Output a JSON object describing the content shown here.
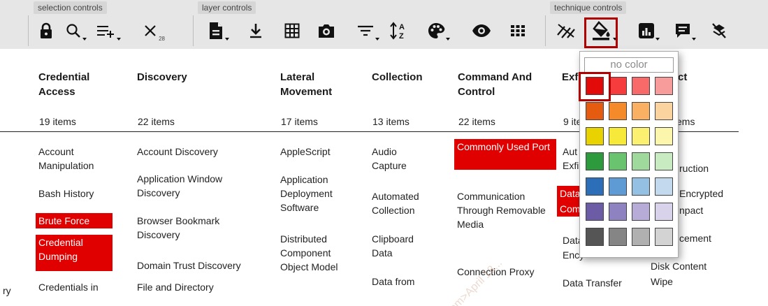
{
  "toolbar": {
    "groups": {
      "selection": "selection controls",
      "layer": "layer controls",
      "technique": "technique controls"
    },
    "icons": {
      "lock": "lock-icon",
      "search": "search-icon",
      "multiselect": "multiselect-icon",
      "deselect": "deselect-icon",
      "deselect_count": "28",
      "layer_info": "layer-info-icon",
      "download": "download-icon",
      "grid": "grid-icon",
      "camera": "camera-icon",
      "filter": "filter-icon",
      "sort": "sort-icon",
      "palette": "palette-icon",
      "eye": "eye-icon",
      "dots": "dots-icon",
      "disable": "disable-icon",
      "fill": "fill-color-icon",
      "score": "score-icon",
      "comment": "comment-icon",
      "clear": "clear-icon"
    }
  },
  "columns": [
    {
      "title": "Credential Access",
      "count": "19 items"
    },
    {
      "title": "Discovery",
      "count": "22 items"
    },
    {
      "title": "Lateral Movement",
      "count": "17 items"
    },
    {
      "title": "Collection",
      "count": "13 items"
    },
    {
      "title": "Command And Control",
      "count": "22 items"
    },
    {
      "title": "Exfi",
      "count": "9 ite"
    },
    {
      "title": "ct",
      "count": "ems"
    }
  ],
  "cells": {
    "c0": [
      "Account Manipulation",
      "Bash History",
      "Brute Force",
      "Credential Dumping",
      "Credentials in"
    ],
    "c1": [
      "Account Discovery",
      "Application Window Discovery",
      "Browser Bookmark Discovery",
      "Domain Trust Discovery",
      "File and Directory"
    ],
    "c2": [
      "AppleScript",
      "Application Deployment Software",
      "Distributed Component Object Model"
    ],
    "c3": [
      "Audio Capture",
      "Automated Collection",
      "Clipboard Data",
      "Data from"
    ],
    "c4": [
      "Commonly Used Port",
      "Communication Through Removable Media",
      "Connection Proxy"
    ],
    "c5": [
      "Aut",
      "Exfil",
      "Data",
      "Com",
      "Data",
      "Ency",
      "Data Transfer"
    ],
    "c6": [
      "ruction",
      "Encrypted",
      "npact",
      "cement",
      "Disk Content",
      "Wipe"
    ],
    "left_edge": "ry"
  },
  "picker": {
    "no_color": "no color",
    "rows": [
      [
        "#e30a0a",
        "#f63c3c",
        "#f86a6a",
        "#f79b9b"
      ],
      [
        "#e55b10",
        "#f58a2a",
        "#f9b063",
        "#fad39f"
      ],
      [
        "#e8d200",
        "#f6e93a",
        "#fbf070",
        "#fcf6ad"
      ],
      [
        "#2e9a3e",
        "#6ac36f",
        "#9fd99b",
        "#c8ebc1"
      ],
      [
        "#2c6fb8",
        "#5e9bd4",
        "#94c0e3",
        "#c3daee"
      ],
      [
        "#6b5ca5",
        "#8f82c0",
        "#b6acd7",
        "#d8d2ea"
      ],
      [
        "#555555",
        "#858585",
        "#b0b0b0",
        "#d3d3d3"
      ]
    ]
  },
  "watermark": "om>April 18..."
}
